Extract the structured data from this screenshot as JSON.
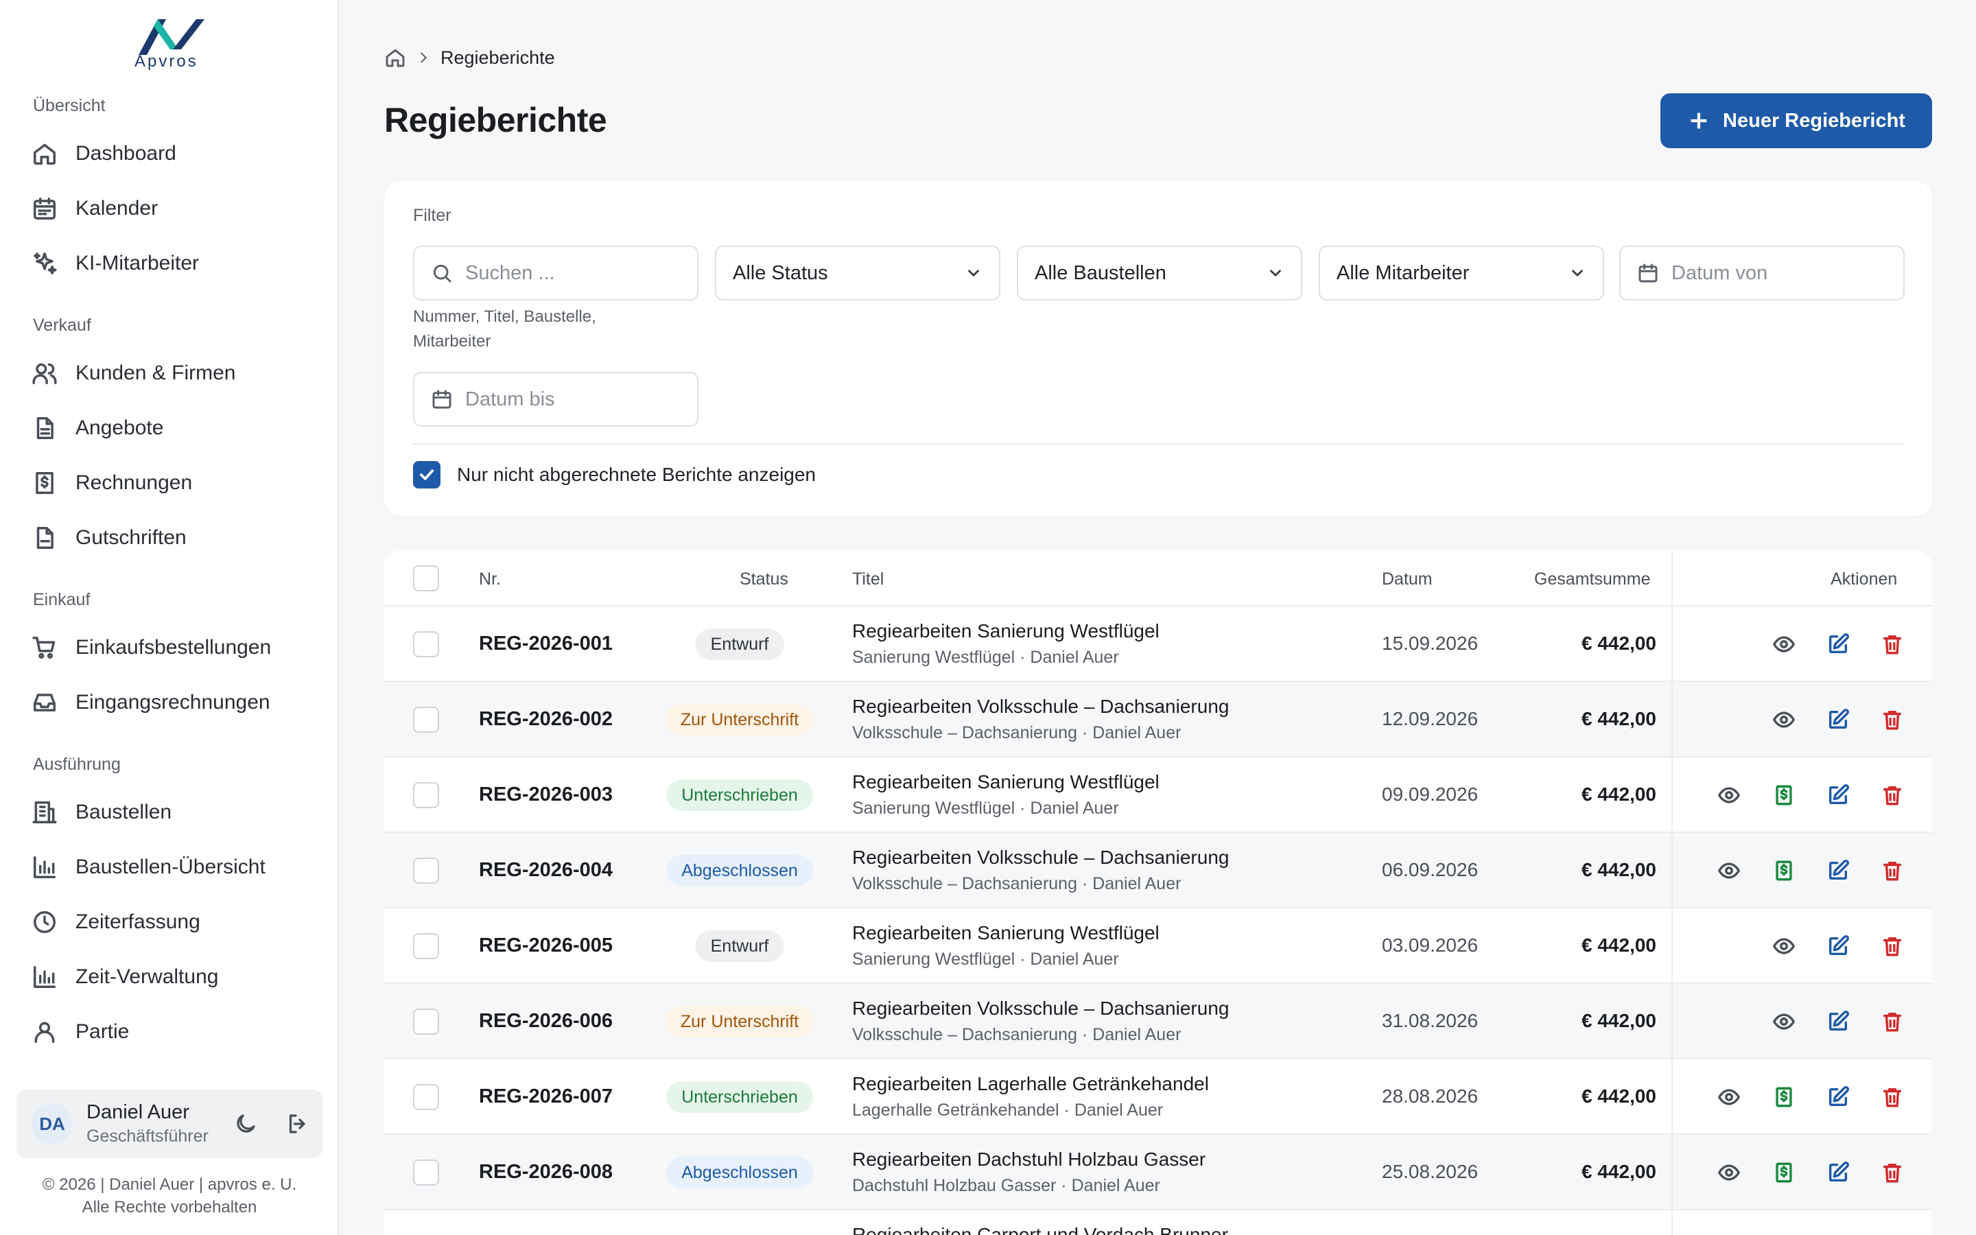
{
  "brand": {
    "name": "Apvros",
    "colors": {
      "primary": "#1e5aa8",
      "logo_dark": "#1b3a6b",
      "logo_accent": "#1bb5a8"
    }
  },
  "sidebar": {
    "sections": [
      {
        "label": "Übersicht",
        "items": [
          {
            "label": "Dashboard",
            "icon": "home-icon"
          },
          {
            "label": "Kalender",
            "icon": "calendar-icon"
          },
          {
            "label": "KI-Mitarbeiter",
            "icon": "sparkles-icon"
          }
        ]
      },
      {
        "label": "Verkauf",
        "items": [
          {
            "label": "Kunden & Firmen",
            "icon": "users-icon"
          },
          {
            "label": "Angebote",
            "icon": "document-icon"
          },
          {
            "label": "Rechnungen",
            "icon": "invoice-dollar-icon"
          },
          {
            "label": "Gutschriften",
            "icon": "file-minus-icon"
          }
        ]
      },
      {
        "label": "Einkauf",
        "items": [
          {
            "label": "Einkaufsbestellungen",
            "icon": "cart-icon"
          },
          {
            "label": "Eingangsrechnungen",
            "icon": "inbox-icon"
          }
        ]
      },
      {
        "label": "Ausführung",
        "items": [
          {
            "label": "Baustellen",
            "icon": "building-icon"
          },
          {
            "label": "Baustellen-Übersicht",
            "icon": "bar-chart-icon"
          },
          {
            "label": "Zeiterfassung",
            "icon": "clock-icon"
          },
          {
            "label": "Zeit-Verwaltung",
            "icon": "bar-chart-icon"
          },
          {
            "label": "Partie",
            "icon": "user-icon"
          }
        ]
      }
    ],
    "user": {
      "initials": "DA",
      "name": "Daniel Auer",
      "role": "Geschäftsführer"
    },
    "footer_line1": "© 2026 | Daniel Auer | apvros e. U.",
    "footer_line2": "Alle Rechte vorbehalten"
  },
  "breadcrumb": {
    "current": "Regieberichte"
  },
  "page": {
    "title": "Regieberichte",
    "new_button": "Neuer Regiebericht"
  },
  "filter": {
    "label": "Filter",
    "search_placeholder": "Suchen ...",
    "search_hint": "Nummer, Titel, Baustelle, Mitarbeiter",
    "status_value": "Alle Status",
    "baustelle_value": "Alle Baustellen",
    "mitarbeiter_value": "Alle Mitarbeiter",
    "date_from_placeholder": "Datum von",
    "date_to_placeholder": "Datum bis",
    "only_unbilled_label": "Nur nicht abgerechnete Berichte anzeigen",
    "only_unbilled_checked": true
  },
  "table": {
    "headers": {
      "nr": "Nr.",
      "status": "Status",
      "titel": "Titel",
      "datum": "Datum",
      "summe": "Gesamtsumme",
      "aktionen": "Aktionen"
    },
    "rows": [
      {
        "nr": "REG-2026-001",
        "status": "Entwurf",
        "status_kind": "entwurf",
        "title": "Regiearbeiten Sanierung Westflügel",
        "subtitle": "Sanierung Westflügel · Daniel Auer",
        "date": "15.09.2026",
        "sum": "€ 442,00",
        "billable": false
      },
      {
        "nr": "REG-2026-002",
        "status": "Zur Unterschrift",
        "status_kind": "unterschrift",
        "title": "Regiearbeiten Volksschule – Dachsanierung",
        "subtitle": "Volksschule – Dachsanierung · Daniel Auer",
        "date": "12.09.2026",
        "sum": "€ 442,00",
        "billable": false
      },
      {
        "nr": "REG-2026-003",
        "status": "Unterschrieben",
        "status_kind": "unterschrieben",
        "title": "Regiearbeiten Sanierung Westflügel",
        "subtitle": "Sanierung Westflügel · Daniel Auer",
        "date": "09.09.2026",
        "sum": "€ 442,00",
        "billable": true
      },
      {
        "nr": "REG-2026-004",
        "status": "Abgeschlossen",
        "status_kind": "abgeschlossen",
        "title": "Regiearbeiten Volksschule – Dachsanierung",
        "subtitle": "Volksschule – Dachsanierung · Daniel Auer",
        "date": "06.09.2026",
        "sum": "€ 442,00",
        "billable": true
      },
      {
        "nr": "REG-2026-005",
        "status": "Entwurf",
        "status_kind": "entwurf",
        "title": "Regiearbeiten Sanierung Westflügel",
        "subtitle": "Sanierung Westflügel · Daniel Auer",
        "date": "03.09.2026",
        "sum": "€ 442,00",
        "billable": false
      },
      {
        "nr": "REG-2026-006",
        "status": "Zur Unterschrift",
        "status_kind": "unterschrift",
        "title": "Regiearbeiten Volksschule – Dachsanierung",
        "subtitle": "Volksschule – Dachsanierung · Daniel Auer",
        "date": "31.08.2026",
        "sum": "€ 442,00",
        "billable": false
      },
      {
        "nr": "REG-2026-007",
        "status": "Unterschrieben",
        "status_kind": "unterschrieben",
        "title": "Regiearbeiten Lagerhalle Getränkehandel",
        "subtitle": "Lagerhalle Getränkehandel · Daniel Auer",
        "date": "28.08.2026",
        "sum": "€ 442,00",
        "billable": true
      },
      {
        "nr": "REG-2026-008",
        "status": "Abgeschlossen",
        "status_kind": "abgeschlossen",
        "title": "Regiearbeiten Dachstuhl Holzbau Gasser",
        "subtitle": "Dachstuhl Holzbau Gasser · Daniel Auer",
        "date": "25.08.2026",
        "sum": "€ 442,00",
        "billable": true
      },
      {
        "nr": "",
        "status": "",
        "status_kind": "entwurf",
        "title": "Regiearbeiten Carport und Vordach Brunner",
        "subtitle": "",
        "date": "",
        "sum": "",
        "billable": false
      }
    ]
  }
}
